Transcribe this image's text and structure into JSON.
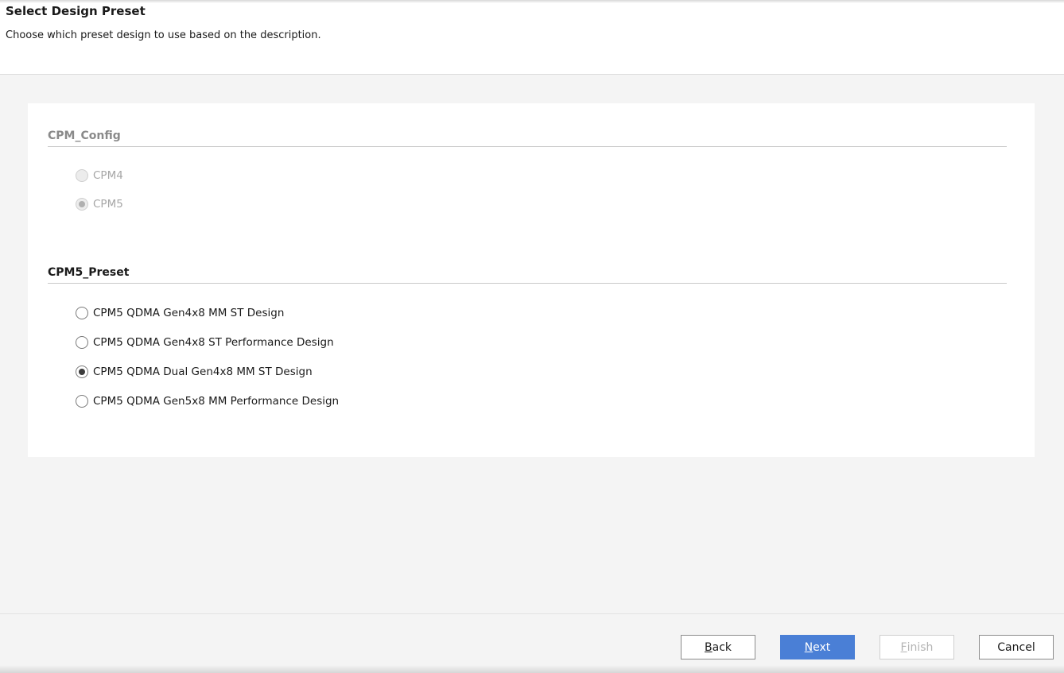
{
  "header": {
    "title": "Select Design Preset",
    "description": "Choose which preset design to use based on the description."
  },
  "cpm_config": {
    "title": "CPM_Config",
    "options": [
      {
        "label": "CPM4",
        "checked": false,
        "disabled": true
      },
      {
        "label": "CPM5",
        "checked": true,
        "disabled": true
      }
    ]
  },
  "cpm5_preset": {
    "title": "CPM5_Preset",
    "options": [
      {
        "label": "CPM5 QDMA Gen4x8 MM ST Design",
        "checked": false
      },
      {
        "label": "CPM5 QDMA Gen4x8 ST Performance Design",
        "checked": false
      },
      {
        "label": "CPM5 QDMA Dual Gen4x8 MM ST Design",
        "checked": true
      },
      {
        "label": "CPM5 QDMA Gen5x8 MM Performance Design",
        "checked": false
      }
    ]
  },
  "footer": {
    "back": {
      "mnemonic": "B",
      "rest": "ack"
    },
    "next": {
      "mnemonic": "N",
      "rest": "ext"
    },
    "finish": {
      "mnemonic": "F",
      "rest": "inish"
    },
    "cancel": "Cancel"
  },
  "colors": {
    "accent": "#4a7fd6",
    "background": "#f4f4f4",
    "panel": "#ffffff"
  }
}
